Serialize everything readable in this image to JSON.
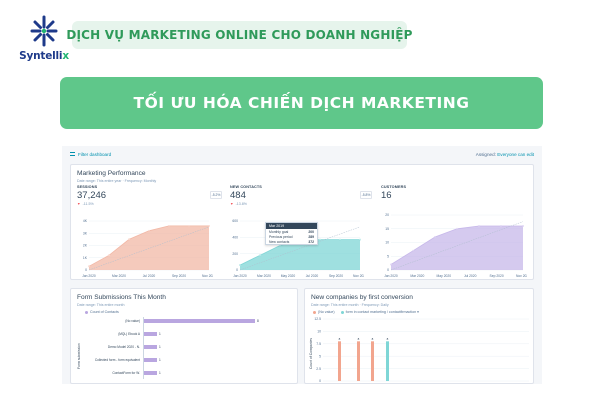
{
  "brand": {
    "name_main": "Syntelli",
    "name_accent": "x",
    "logo_icon": "asterisk-burst-icon"
  },
  "tagline": "DỊCH VỤ MARKETING ONLINE CHO DOANH NGHIỆP",
  "banner": "TỐI ƯU HÓA CHIẾN DỊCH MARKETING",
  "colors": {
    "tagline_bg": "#e6f4ec",
    "tagline_text": "#2f9a5a",
    "banner_bg": "#5fc78a",
    "logo_navy": "#1e3a8a",
    "logo_green": "#22b573"
  },
  "dashboard": {
    "filter_label": "Filter dashboard",
    "assigned_label": "Assigned:",
    "assigned_value": "Everyone can edit",
    "performance": {
      "title": "Marketing Performance",
      "subtitle": "Date range: This entire year · Frequency: Monthly",
      "metrics": [
        {
          "label": "SESSIONS",
          "value": "37,246",
          "change": "-11.5%",
          "pct_box": "-5.2%"
        },
        {
          "label": "NEW CONTACTS",
          "value": "484",
          "change": "-13.8%",
          "pct_box": "-5.8%"
        },
        {
          "label": "CUSTOMERS",
          "value": "16",
          "change": "",
          "pct_box": ""
        }
      ],
      "tooltip": {
        "head": "Mar 2019",
        "rows": [
          {
            "label": "Monthly goal",
            "value": "200"
          },
          {
            "label": "Previous period",
            "value": "289"
          },
          {
            "label": "New contacts",
            "value": "372"
          }
        ]
      }
    },
    "form": {
      "title": "Form Submissions This Month",
      "subtitle": "Date range: This entire month",
      "legend": "Count of Contacts",
      "y_axis": "Form submission",
      "bars": [
        {
          "label": "(No value)",
          "value": "8"
        },
        {
          "label": "(MQL) Ebook A",
          "value": "1"
        },
        {
          "label": "Demo Model 2020 - N.",
          "value": "1"
        },
        {
          "label": "Collected form - form equivalent",
          "value": "1"
        },
        {
          "label": "ContactForm for W.",
          "value": "1"
        }
      ]
    },
    "companies": {
      "title": "New companies by first conversion",
      "subtitle": "Date range: This entire month · Frequency: Daily",
      "legend_a": "(No value)",
      "legend_b": "form in contact marketing / contactfirmaction ▾",
      "y_axis": "Count of Companies",
      "y_ticks": [
        "12.5",
        "10",
        "7.5",
        "5",
        "2.5",
        "0"
      ],
      "bar_value": "8"
    }
  },
  "chart_data": [
    {
      "type": "area",
      "title": "",
      "categories": [
        "Jan 2020",
        "Mar 2020",
        "Jul 2020",
        "Sep 2020",
        "Nov 2020"
      ],
      "y_ticks": [
        "4K",
        "3K",
        "2K",
        "1K",
        "0"
      ],
      "series": [
        {
          "name": "",
          "values": [
            0.3,
            1.2,
            2.5,
            3.2,
            3.6,
            3.6,
            3.6
          ]
        }
      ],
      "color": "#f2b8a6"
    },
    {
      "type": "area",
      "title": "",
      "categories": [
        "Jan 2020",
        "Mar 2020",
        "May 2020",
        "Jul 2020",
        "Sep 2020",
        "Nov 2020"
      ],
      "y_ticks": [
        "600",
        "400",
        "200",
        "0"
      ],
      "series": [
        {
          "name": "",
          "values": [
            60,
            180,
            300,
            360,
            372,
            372,
            372
          ]
        }
      ],
      "color": "#7fd6d6"
    },
    {
      "type": "area",
      "title": "",
      "categories": [
        "Jan 2020",
        "Mar 2020",
        "May 2020",
        "Jul 2020",
        "Sep 2020",
        "Nov 2020"
      ],
      "y_ticks": [
        "20",
        "15",
        "10",
        "5",
        "0"
      ],
      "series": [
        {
          "name": "",
          "values": [
            2,
            7,
            12,
            15,
            16,
            16,
            16
          ]
        }
      ],
      "color": "#c7b8ea"
    }
  ]
}
